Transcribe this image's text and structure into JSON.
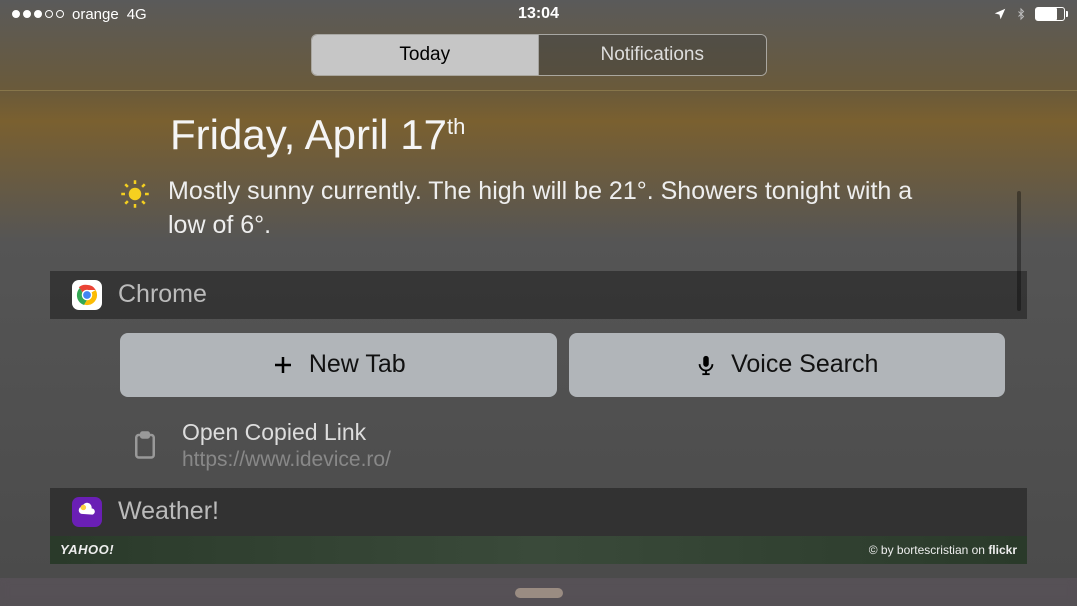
{
  "status": {
    "carrier": "orange",
    "network": "4G",
    "time": "13:04"
  },
  "tabs": {
    "today": "Today",
    "notifications": "Notifications"
  },
  "today": {
    "date_main": "Friday, April 17",
    "date_ord": "th",
    "weather_summary": "Mostly sunny currently. The high will be 21°. Showers tonight with a low of 6°."
  },
  "chrome": {
    "title": "Chrome",
    "new_tab": "New Tab",
    "voice_search": "Voice Search",
    "copied_title": "Open Copied Link",
    "copied_url": "https://www.idevice.ro/"
  },
  "weather_widget": {
    "title": "Weather!",
    "brand": "YAHOO!",
    "credit_prefix": "© by bortescristian on ",
    "credit_brand": "flickr"
  }
}
